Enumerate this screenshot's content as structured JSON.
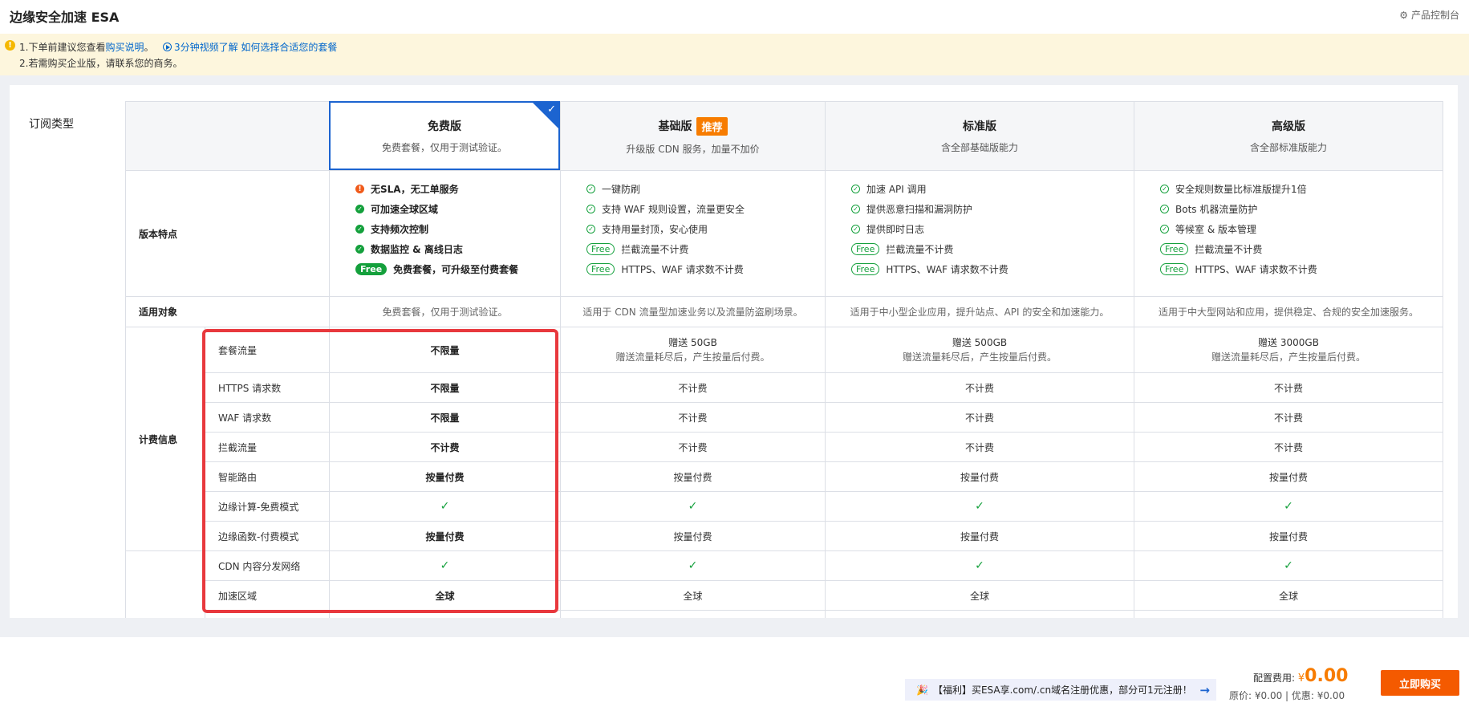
{
  "app_title": "边缘安全加速 ESA",
  "console_link": "产品控制台",
  "notice": {
    "line1_prefix": "1.下单前建议您查看",
    "line1_link": "购买说明",
    "line1_suffix": "。",
    "video_link": "3分钟视频了解 如何选择合适您的套餐",
    "line2": "2.若需购买企业版，请联系您的商务。"
  },
  "subscription_label": "订阅类型",
  "plans": [
    {
      "name": "免费版",
      "desc": "免费套餐，仅用于测试验证。",
      "badge": ""
    },
    {
      "name": "基础版",
      "desc": "升级版 CDN 服务，加量不加价",
      "badge": "推荐"
    },
    {
      "name": "标准版",
      "desc": "含全部基础版能力",
      "badge": ""
    },
    {
      "name": "高级版",
      "desc": "含全部标准版能力",
      "badge": ""
    }
  ],
  "row_labels": {
    "features": "版本特点",
    "audience": "适用对象",
    "billing": "计费信息"
  },
  "features": {
    "free": [
      "无SLA，无工单服务",
      "可加速全球区域",
      "支持频次控制",
      "数据监控 & 离线日志",
      "免费套餐，可升级至付费套餐"
    ],
    "basic": [
      "一键防刷",
      "支持 WAF 规则设置，流量更安全",
      "支持用量封顶，安心使用",
      "拦截流量不计费",
      "HTTPS、WAF 请求数不计费"
    ],
    "standard": [
      "加速 API 调用",
      "提供恶意扫描和漏洞防护",
      "提供即时日志",
      "拦截流量不计费",
      "HTTPS、WAF 请求数不计费"
    ],
    "premium": [
      "安全规则数量比标准版提升1倍",
      "Bots 机器流量防护",
      "等候室 & 版本管理",
      "拦截流量不计费",
      "HTTPS、WAF 请求数不计费"
    ],
    "free_tag": "Free"
  },
  "audience": [
    "免费套餐，仅用于测试验证。",
    "适用于 CDN 流量型加速业务以及流量防盗刷场景。",
    "适用于中小型企业应用，提升站点、API 的安全和加速能力。",
    "适用于中大型网站和应用，提供稳定、合规的安全加速服务。"
  ],
  "billing_rows": [
    {
      "label": "套餐流量",
      "values": [
        "不限量",
        "赠送 50GB",
        "赠送 500GB",
        "赠送 3000GB"
      ],
      "notes": [
        "",
        "赠送流量耗尽后，产生按量后付费。",
        "赠送流量耗尽后，产生按量后付费。",
        "赠送流量耗尽后，产生按量后付费。"
      ]
    },
    {
      "label": "HTTPS 请求数",
      "values": [
        "不限量",
        "不计费",
        "不计费",
        "不计费"
      ]
    },
    {
      "label": "WAF 请求数",
      "values": [
        "不限量",
        "不计费",
        "不计费",
        "不计费"
      ]
    },
    {
      "label": "拦截流量",
      "values": [
        "不计费",
        "不计费",
        "不计费",
        "不计费"
      ]
    },
    {
      "label": "智能路由",
      "values": [
        "按量付费",
        "按量付费",
        "按量付费",
        "按量付费"
      ]
    },
    {
      "label": "边缘计算-免费模式",
      "values": [
        "✓",
        "✓",
        "✓",
        "✓"
      ]
    },
    {
      "label": "边缘函数-付费模式",
      "values": [
        "按量付费",
        "按量付费",
        "按量付费",
        "按量付费"
      ]
    }
  ],
  "extra_rows": [
    {
      "label": "CDN 内容分发网络",
      "values": [
        "✓",
        "✓",
        "✓",
        "✓"
      ]
    },
    {
      "label": "加速区域",
      "values": [
        "全球",
        "全球",
        "全球",
        "全球"
      ]
    }
  ],
  "footer": {
    "promo": "【福利】买ESA享.com/.cn域名注册优惠，部分可1元注册！",
    "fee_label": "配置费用:",
    "currency": "¥",
    "fee_amount": "0.00",
    "orig": "原价: ¥0.00 | 优惠: ¥0.00",
    "buy": "立即购买"
  },
  "colors": {
    "accent_blue": "#1c64d0",
    "orange": "#f77c00",
    "green": "#14a03c",
    "red_highlight": "#e8383d"
  }
}
